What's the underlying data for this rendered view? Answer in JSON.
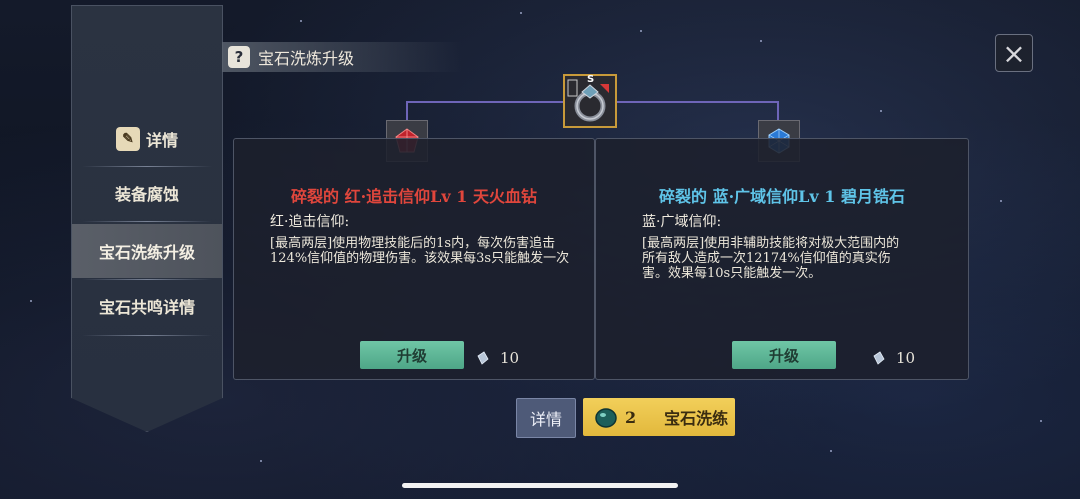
{
  "header": {
    "title": "宝石洗炼升级"
  },
  "sidebar": {
    "items": [
      {
        "label": "详情"
      },
      {
        "label": "装备腐蚀"
      },
      {
        "label": "宝石洗练升级",
        "active": true
      },
      {
        "label": "宝石共鸣详情"
      }
    ]
  },
  "left_card": {
    "title": "碎裂的 红·追击信仰Lv 1 天火血钻",
    "title_color": "#e0463c",
    "subtitle": "红·追击信仰:",
    "description": "[最高两层]使用物理技能后的1s内，每次伤害追击124%信仰值的物理伤害。该效果每3s只能触发一次",
    "upgrade_label": "升级",
    "cost": "10"
  },
  "right_card": {
    "title": "碎裂的 蓝·广域信仰Lv 1 碧月锆石",
    "title_color": "#5fc4e8",
    "subtitle": "蓝·广域信仰:",
    "description": "[最高两层]使用非辅助技能将对极大范围内的所有敌人造成一次12174%信仰值的真实伤害。效果每10s只能触发一次。",
    "upgrade_label": "升级",
    "cost": "10"
  },
  "footer": {
    "detail_label": "详情",
    "wash_count": "2",
    "wash_label": "宝石洗练"
  },
  "ring": {
    "badge": "S"
  },
  "icons": {
    "close": "close-icon",
    "help": "help-icon",
    "red_gem": "red-gem-icon",
    "blue_gem": "blue-gem-icon",
    "crystal": "crystal-icon",
    "wash_gem": "wash-gem-icon"
  }
}
